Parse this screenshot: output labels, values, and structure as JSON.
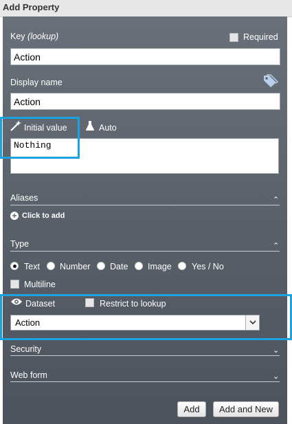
{
  "window": {
    "title": "Add Property"
  },
  "key": {
    "label": "Key",
    "hint": "(lookup)",
    "value": "Action",
    "required_label": "Required",
    "required_checked": false
  },
  "display_name": {
    "label": "Display name",
    "value": "Action"
  },
  "initial_value": {
    "label": "Initial value",
    "auto_label": "Auto",
    "value": "Nothing"
  },
  "aliases": {
    "label": "Aliases",
    "add_label": "Click to add",
    "expanded": true
  },
  "type": {
    "label": "Type",
    "options": [
      "Text",
      "Number",
      "Date",
      "Image",
      "Yes / No"
    ],
    "selected": "Text",
    "multiline_label": "Multiline",
    "multiline_checked": false
  },
  "dataset": {
    "label": "Dataset",
    "restrict_label": "Restrict to lookup",
    "restrict_checked": false,
    "selected": "Action"
  },
  "security": {
    "label": "Security",
    "expanded": false
  },
  "web_form": {
    "label": "Web form",
    "expanded": false
  },
  "buttons": {
    "add": "Add",
    "add_and_new": "Add and New"
  },
  "colors": {
    "panel": "#5d646d",
    "highlight": "#1aa3e0"
  },
  "icons": {
    "tag": "tag-icon",
    "wand": "magic-wand-icon",
    "flask": "flask-icon",
    "plus": "plus-circle-icon",
    "eye": "eye-icon",
    "chevron_up": "chevron-up-icon",
    "chevron_down": "chevron-down-icon"
  }
}
